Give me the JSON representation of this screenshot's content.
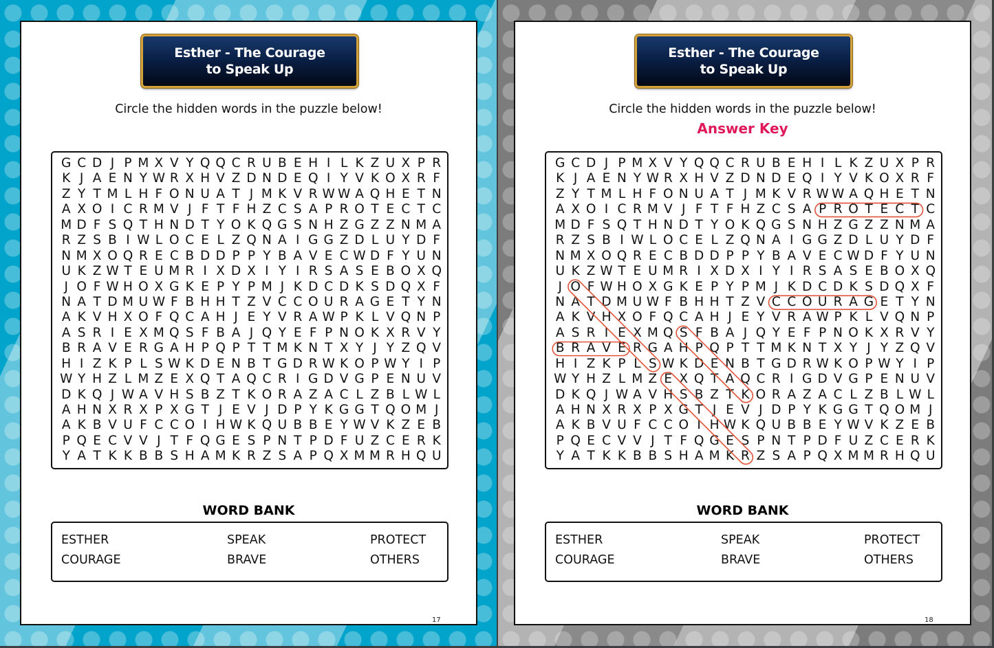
{
  "pages": [
    {
      "title_line1": "Esther - The Courage",
      "title_line2": "to Speak Up",
      "instructions": "Circle the hidden words in the puzzle below!",
      "word_bank_title": "WORD BANK",
      "word_bank": [
        "ESTHER",
        "SPEAK",
        "PROTECT",
        "COURAGE",
        "BRAVE",
        "OTHERS"
      ],
      "page_number": "17"
    },
    {
      "title_line1": "Esther - The Courage",
      "title_line2": "to Speak Up",
      "instructions": "Circle the hidden words in the puzzle below!",
      "answer_key_label": "Answer Key",
      "word_bank_title": "WORD BANK",
      "word_bank": [
        "ESTHER",
        "SPEAK",
        "PROTECT",
        "COURAGE",
        "BRAVE",
        "OTHERS"
      ],
      "page_number": "18"
    }
  ],
  "grid": [
    "GCDJPMXVYQQCRUBEHILKZUXPR",
    "KJAENYWRXHVZDNDEQIYVKOXRF",
    "ZYTMLHFONUATJMKVRWWAQHETN",
    "AXOICRMVJFTFHZCSAPROTECTC",
    "MDFSQTHNDTYOKQGSNHZGZZNMA",
    "RZSBIWLOCELZQNAIGGZDLUYDF",
    "NMXOQRECBDDPPYBAVECWDFYUN",
    "UKZWTEUMRIXDXIYIRSASEBOXQ",
    "JOFWHOXGKEPYPMJKDCDKSDQXF",
    "NATDMUWFBHHTZVCCOURAGETYN",
    "AKVHXOFQCAHJEYVRAWPKLVQNP",
    "ASRIEXMQSFBAJQYEFPNOKXRVY",
    "BRAVERGAHPQPTTMKNTXYJYZQV",
    "HIZKPLSWKDENBTGDRWKOPWYIP",
    "WYHZLMZEXQTAQCRIGDVGPENUV",
    "DKQJWAVHSBZTKORAZACLZBLWL",
    "AHNXRXPXGTJEVJDPYKGGTQOMJ",
    "AKBVUFCCOIHWKQUBBEYWVKZEB",
    "PQECVVJTFQGESPNTPDFUZCERK",
    "YATKKBBSHAMKRZSAPQXMMRHQU"
  ],
  "answers": [
    {
      "word": "PROTECT",
      "start": [
        3,
        17
      ],
      "end": [
        3,
        23
      ]
    },
    {
      "word": "COURAGE",
      "start": [
        9,
        14
      ],
      "end": [
        9,
        20
      ]
    },
    {
      "word": "BRAVE",
      "start": [
        12,
        0
      ],
      "end": [
        12,
        4
      ]
    },
    {
      "word": "OTHERS",
      "start": [
        8,
        1
      ],
      "end": [
        13,
        6
      ]
    },
    {
      "word": "SPEAK",
      "start": [
        11,
        8
      ],
      "end": [
        15,
        12
      ]
    },
    {
      "word": "ESTHER",
      "start": [
        14,
        7
      ],
      "end": [
        19,
        12
      ]
    }
  ],
  "colors": {
    "answer_key": "#e0195a",
    "circle": "#e0533a",
    "left_background": "#02a4cb",
    "right_background": "#9a9a9a",
    "banner": "#0b2148",
    "banner_border": "#d4a23a"
  }
}
